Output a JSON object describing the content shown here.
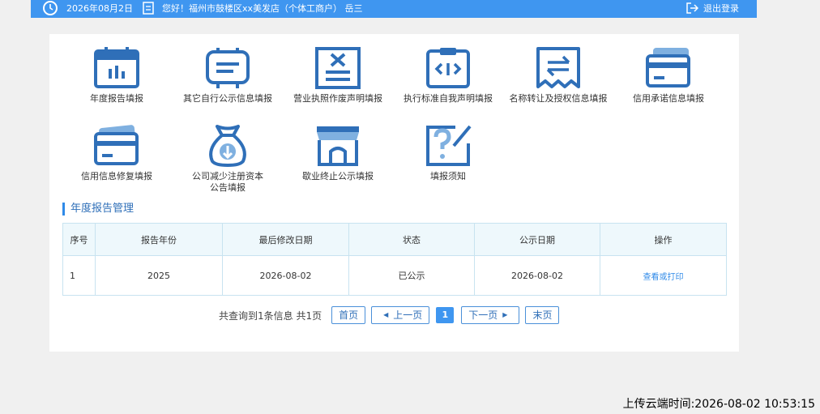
{
  "header": {
    "date": "2026年08月2日",
    "greeting": "您好！福州市鼓楼区xx美发店（个体工商户） 岳三",
    "logout_label": "退出登录"
  },
  "tiles": [
    {
      "label": "年度报告填报",
      "icon": "calendar-icon"
    },
    {
      "label": "其它自行公示信息填报",
      "icon": "document-board-icon"
    },
    {
      "label": "营业执照作废声明填报",
      "icon": "void-document-icon"
    },
    {
      "label": "执行标准自我声明填报",
      "icon": "code-clipboard-icon"
    },
    {
      "label": "名称转让及授权信息填报",
      "icon": "transfer-receipt-icon"
    },
    {
      "label": "信用承诺信息填报",
      "icon": "credit-card-icon"
    },
    {
      "label": "信用信息修复填报",
      "icon": "credit-cards-icon"
    },
    {
      "label_line1": "公司减少注册资本",
      "label_line2": "公告填报",
      "icon": "money-bag-icon"
    },
    {
      "label": "歇业终止公示填报",
      "icon": "store-icon"
    },
    {
      "label": "填报须知",
      "icon": "question-edit-icon"
    }
  ],
  "section_title": "年度报告管理",
  "table": {
    "headers": [
      "序号",
      "报告年份",
      "最后修改日期",
      "状态",
      "公示日期",
      "操作"
    ],
    "rows": [
      {
        "index": "1",
        "year": "2025",
        "modified": "2026-08-02",
        "status": "已公示",
        "published": "2026-08-02",
        "action": "查看或打印"
      }
    ]
  },
  "pager": {
    "info": "共查询到1条信息 共1页",
    "first": "首页",
    "prev": "上一页",
    "current": "1",
    "next": "下一页",
    "last": "末页"
  },
  "upload_time": "上传云端时间:2026-08-02 10:53:15",
  "colors": {
    "header_blue": "#3f96f0",
    "icon_blue": "#2f6fb8",
    "accent": "#2f8ae8"
  }
}
